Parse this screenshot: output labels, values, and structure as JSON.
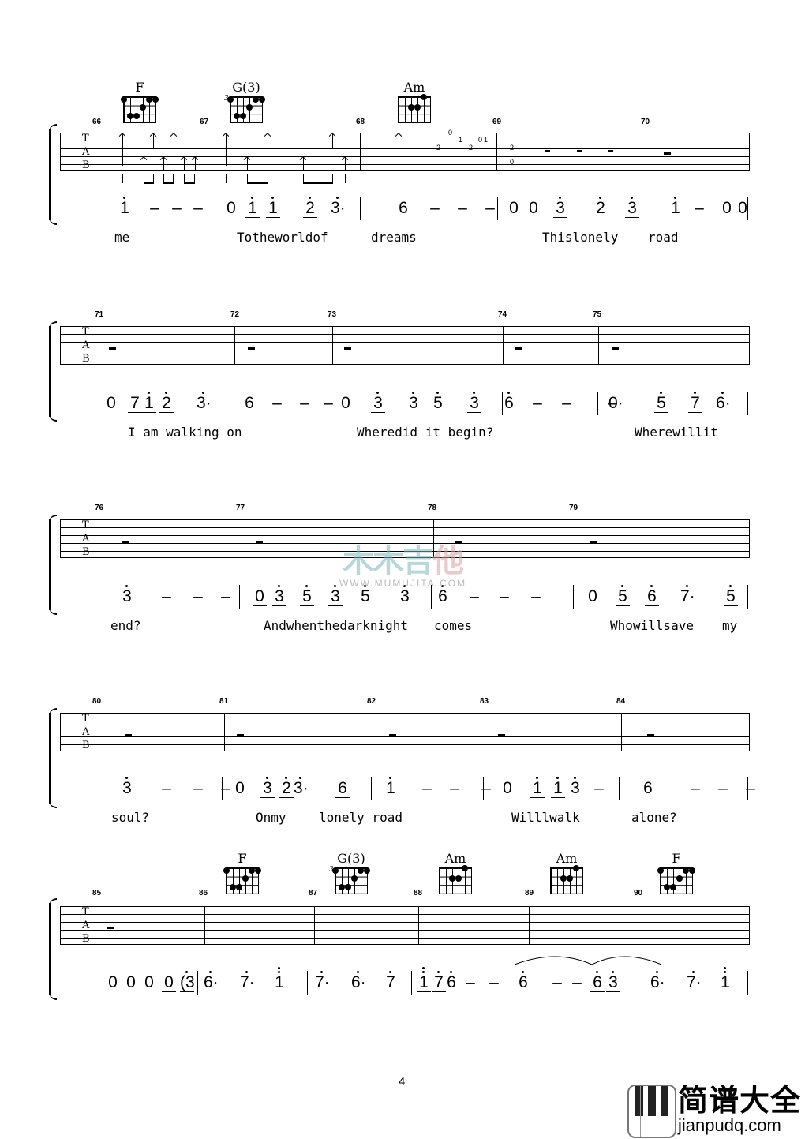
{
  "page_number": "4",
  "tab_letters": [
    "T",
    "A",
    "B"
  ],
  "watermark": {
    "cn_1": "木木",
    "cn_2": "吉",
    "cn_3": "他",
    "url": "WWW.MUMUJITA.COM"
  },
  "logo": {
    "cn": "简谱大全",
    "url": "jianpudq.com"
  },
  "systems": [
    {
      "measures": [
        {
          "num": "66",
          "chord": "F",
          "notation": [
            "1̇",
            "–",
            "–",
            "–"
          ],
          "lyric": "me"
        },
        {
          "num": "67",
          "chord": "G(3)",
          "notation": [
            "0",
            "1̇",
            "1̇",
            "2̇",
            "3̇·"
          ],
          "lyric": "Totheworldof"
        },
        {
          "num": "68",
          "chord": "Am",
          "notation": [
            "6",
            "–",
            "–",
            "–"
          ],
          "lyric": "dreams",
          "tab_numbers": [
            "2",
            "0",
            "1",
            "2",
            "0",
            "1"
          ]
        },
        {
          "num": "69",
          "notation": [
            "0",
            "0",
            "3̇",
            "2̇",
            "3̇"
          ],
          "lyric": "Thislonely",
          "tab_numbers": [
            "2",
            "0"
          ]
        },
        {
          "num": "70",
          "notation": [
            "1̇",
            "–",
            "0",
            "0"
          ],
          "lyric": "road"
        }
      ]
    },
    {
      "measures": [
        {
          "num": "71",
          "notation": [
            "0",
            "7",
            "1̇",
            "2̇",
            "3̇·"
          ],
          "lyric": "I am walking on"
        },
        {
          "num": "72",
          "notation": [
            "6",
            "–",
            "–",
            "–"
          ],
          "lyric": ""
        },
        {
          "num": "73",
          "notation": [
            "0",
            "3̇",
            "3̇",
            "5̇",
            "3̇"
          ],
          "lyric": "Wheredid it begin?"
        },
        {
          "num": "74",
          "notation": [
            "6̇",
            "–",
            "–",
            "–"
          ],
          "lyric": ""
        },
        {
          "num": "75",
          "notation": [
            "0·",
            "5̇",
            "7̇",
            "6̇·"
          ],
          "lyric": "Wherewillit"
        }
      ]
    },
    {
      "measures": [
        {
          "num": "76",
          "notation": [
            "3̇",
            "–",
            "–",
            "–"
          ],
          "lyric": "end?"
        },
        {
          "num": "77",
          "notation": [
            "0",
            "3̇",
            "5̇",
            "3̇",
            "5̇",
            "3̇"
          ],
          "lyric": "Andwhenthedarknight"
        },
        {
          "num": "78",
          "notation": [
            "6̇",
            "–",
            "–",
            "–"
          ],
          "lyric": "comes"
        },
        {
          "num": "79",
          "notation": [
            "0",
            "5̇",
            "6̇",
            "7̇·",
            "5̇"
          ],
          "lyric": "Whowillsave my"
        }
      ]
    },
    {
      "measures": [
        {
          "num": "80",
          "notation": [
            "3̇",
            "–",
            "–",
            "–"
          ],
          "lyric": "soul?"
        },
        {
          "num": "81",
          "notation": [
            "0",
            "3̇",
            "2̇",
            "3̇·",
            "6"
          ],
          "lyric": "Onmy lonely road"
        },
        {
          "num": "82",
          "notation": [
            "1̇",
            "–",
            "–",
            "–"
          ],
          "lyric": ""
        },
        {
          "num": "83",
          "notation": [
            "0",
            "1̇",
            "1̇",
            "3̇",
            "–"
          ],
          "lyric": "Willlwalk"
        },
        {
          "num": "84",
          "notation": [
            "6",
            "–",
            "–",
            "–"
          ],
          "lyric": "alone?"
        }
      ]
    },
    {
      "measures": [
        {
          "num": "85",
          "notation": [
            "0",
            "0",
            "0",
            "0",
            "(3̇"
          ],
          "lyric": ""
        },
        {
          "num": "86",
          "chord": "F",
          "notation": [
            "6̇·",
            "7̇·",
            "1̈"
          ],
          "lyric": ""
        },
        {
          "num": "87",
          "chord": "G(3)",
          "notation": [
            "7̇·",
            "6̇·",
            "7̇"
          ],
          "lyric": ""
        },
        {
          "num": "88",
          "chord": "Am",
          "notation": [
            "1̈",
            "7̇",
            "6̇",
            "–",
            "–"
          ],
          "lyric": ""
        },
        {
          "num": "89",
          "chord": "Am",
          "notation": [
            "6̇",
            "–",
            "–",
            "6̇",
            "3̇"
          ],
          "lyric": ""
        },
        {
          "num": "90",
          "chord": "F",
          "notation": [
            "6̇·",
            "7̇·",
            "1̈"
          ],
          "lyric": ""
        }
      ]
    }
  ],
  "sys1": {
    "n": [
      [
        "1",
        "dot"
      ],
      [
        "–",
        ""
      ],
      [
        "–",
        ""
      ],
      [
        "–",
        ""
      ],
      [
        "0",
        ""
      ],
      [
        "1",
        "dot ul"
      ],
      [
        "1",
        "dot ul"
      ],
      [
        "2",
        "dot ul"
      ],
      [
        "3·",
        "dot"
      ],
      [
        "6",
        ""
      ],
      [
        "–",
        ""
      ],
      [
        "–",
        ""
      ],
      [
        "–",
        ""
      ],
      [
        "0",
        ""
      ],
      [
        "0",
        ""
      ],
      [
        "3",
        "dot ul"
      ],
      [
        "2",
        "dot"
      ],
      [
        "3",
        "dot ul"
      ],
      [
        "1",
        "dot"
      ],
      [
        "–",
        ""
      ],
      [
        "0",
        ""
      ],
      [
        "0",
        ""
      ]
    ],
    "lyrics": [
      "me",
      "Totheworldof",
      "dreams",
      "Thislonely",
      "road"
    ]
  },
  "sys2": {
    "n": [
      [
        "0",
        ""
      ],
      [
        "7",
        "ul"
      ],
      [
        "1",
        "dot ul"
      ],
      [
        "2",
        "dot ul"
      ],
      [
        "3·",
        "dot"
      ],
      [
        "6",
        ""
      ],
      [
        "–",
        ""
      ],
      [
        "–",
        ""
      ],
      [
        "–",
        ""
      ],
      [
        "0",
        ""
      ],
      [
        "3",
        "dot ul"
      ],
      [
        "3",
        "dot"
      ],
      [
        "5",
        "dot"
      ],
      [
        "3",
        "dot ul"
      ],
      [
        "6",
        "dot"
      ],
      [
        "–",
        ""
      ],
      [
        "–",
        ""
      ],
      [
        "–",
        ""
      ],
      [
        "0·",
        ""
      ],
      [
        "5",
        "dot ul"
      ],
      [
        "7",
        "dot ul"
      ],
      [
        "6·",
        "dot"
      ]
    ],
    "lyrics": [
      "I am walking on",
      "Wheredid it begin?",
      "Wherewillit"
    ]
  },
  "sys3": {
    "n": [
      [
        "3",
        "dot"
      ],
      [
        "–",
        ""
      ],
      [
        "–",
        ""
      ],
      [
        "–",
        ""
      ],
      [
        "0",
        "ul"
      ],
      [
        "3",
        "dot ul"
      ],
      [
        "5",
        "dot ul"
      ],
      [
        "3",
        "dot ul"
      ],
      [
        "5",
        "dot"
      ],
      [
        "3",
        "dot"
      ],
      [
        "6",
        "dot"
      ],
      [
        "–",
        ""
      ],
      [
        "–",
        ""
      ],
      [
        "–",
        ""
      ],
      [
        "0",
        ""
      ],
      [
        "5",
        "dot ul"
      ],
      [
        "6",
        "dot ul"
      ],
      [
        "7·",
        "dot"
      ],
      [
        "5",
        "dot ul"
      ]
    ],
    "lyrics": [
      "end?",
      "Andwhenthedarknight",
      "comes",
      "Whowillsave",
      "my"
    ]
  },
  "sys4": {
    "n": [
      [
        "3",
        "dot"
      ],
      [
        "–",
        ""
      ],
      [
        "–",
        ""
      ],
      [
        "–",
        ""
      ],
      [
        "0",
        ""
      ],
      [
        "3",
        "dot ul"
      ],
      [
        "2",
        "dot ul"
      ],
      [
        "3·",
        "dot"
      ],
      [
        "6",
        "ul"
      ],
      [
        "1",
        "dot"
      ],
      [
        "–",
        ""
      ],
      [
        "–",
        ""
      ],
      [
        "–",
        ""
      ],
      [
        "0",
        ""
      ],
      [
        "1",
        "dot ul"
      ],
      [
        "1",
        "dot ul"
      ],
      [
        "3",
        "dot"
      ],
      [
        "–",
        ""
      ],
      [
        "6",
        ""
      ],
      [
        "–",
        ""
      ],
      [
        "–",
        ""
      ],
      [
        "–",
        ""
      ]
    ],
    "lyrics": [
      "soul?",
      "Onmy",
      "lonely road",
      "Willlwalk",
      "alone?"
    ]
  },
  "sys5": {
    "n": [
      [
        "0",
        ""
      ],
      [
        "0",
        ""
      ],
      [
        "0",
        ""
      ],
      [
        "0",
        "ul"
      ],
      [
        "(3",
        "dot ul"
      ],
      [
        "6·",
        "dot"
      ],
      [
        "7·",
        "dot"
      ],
      [
        "1",
        "ddot"
      ],
      [
        "7·",
        "dot"
      ],
      [
        "6·",
        "dot"
      ],
      [
        "7",
        "dot"
      ],
      [
        "1",
        "ddot ul"
      ],
      [
        "7",
        "dot ul"
      ],
      [
        "6",
        "dot"
      ],
      [
        "–",
        ""
      ],
      [
        "–",
        ""
      ],
      [
        "6",
        "dot"
      ],
      [
        "–",
        ""
      ],
      [
        "–",
        ""
      ],
      [
        "6",
        "dot ul"
      ],
      [
        "3",
        "dot ul"
      ],
      [
        "6·",
        "dot"
      ],
      [
        "7·",
        "dot"
      ],
      [
        "1",
        "ddot"
      ]
    ]
  }
}
